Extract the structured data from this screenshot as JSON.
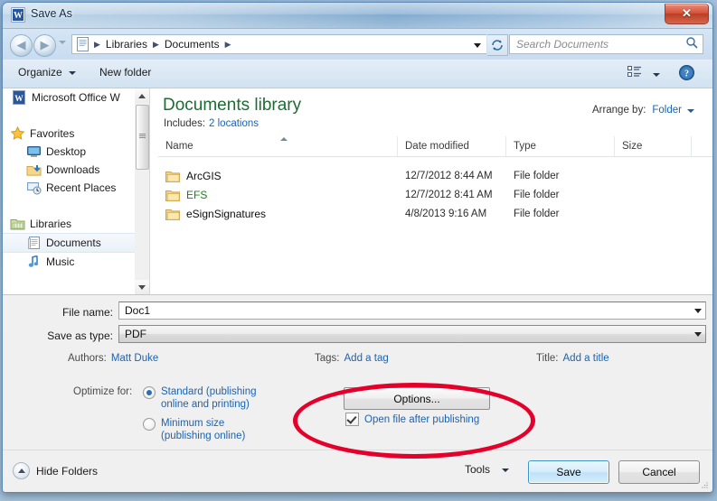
{
  "window": {
    "title": "Save As",
    "title_icon": "word-document-icon",
    "close_label": "✕"
  },
  "addressbar": {
    "back_icon": "back-arrow-icon",
    "forward_icon": "forward-arrow-icon",
    "history_icon": "history-dropdown-icon",
    "crumb_icon": "documents-library-icon",
    "crumbs": [
      "Libraries",
      "Documents"
    ],
    "separator": "▶",
    "refresh_icon": "refresh-icon",
    "search": {
      "placeholder": "Search Documents",
      "icon": "search-icon"
    }
  },
  "toolbar": {
    "organize": "Organize",
    "new_folder": "New folder",
    "view_icon": "view-list-icon",
    "help_icon": "help-icon"
  },
  "navpane": {
    "items": [
      {
        "label": "Microsoft Office W",
        "icon": "word-app-icon",
        "indent": 10,
        "selected": false
      },
      {
        "label": "",
        "icon": "spacer",
        "indent": 10,
        "selected": false
      },
      {
        "label": "Favorites",
        "icon": "favorites-star-icon",
        "indent": 8,
        "selected": false
      },
      {
        "label": "Desktop",
        "icon": "desktop-icon",
        "indent": 26,
        "selected": false
      },
      {
        "label": "Downloads",
        "icon": "downloads-icon",
        "indent": 26,
        "selected": false
      },
      {
        "label": "Recent Places",
        "icon": "recent-places-icon",
        "indent": 26,
        "selected": false
      },
      {
        "label": "",
        "icon": "spacer",
        "indent": 10,
        "selected": false
      },
      {
        "label": "Libraries",
        "icon": "libraries-icon",
        "indent": 8,
        "selected": false
      },
      {
        "label": "Documents",
        "icon": "documents-icon",
        "indent": 26,
        "selected": true
      },
      {
        "label": "Music",
        "icon": "music-icon",
        "indent": 26,
        "selected": false
      }
    ],
    "scrollbar": {
      "up_icon": "scroll-up-arrow-icon",
      "down_icon": "scroll-down-arrow-icon"
    }
  },
  "library": {
    "title": "Documents library",
    "includes_label": "Includes:",
    "includes_value": "2 locations",
    "arrange_label": "Arrange by:",
    "arrange_value": "Folder"
  },
  "filelist": {
    "columns": [
      "Name",
      "Date modified",
      "Type",
      "Size"
    ],
    "sorted_column": "Name",
    "rows": [
      {
        "name": "ArcGIS",
        "date": "12/7/2012 8:44 AM",
        "type": "File folder",
        "size": "",
        "encrypted": false
      },
      {
        "name": "EFS",
        "date": "12/7/2012 8:41 AM",
        "type": "File folder",
        "size": "",
        "encrypted": true
      },
      {
        "name": "eSignSignatures",
        "date": "4/8/2013 9:16 AM",
        "type": "File folder",
        "size": "",
        "encrypted": false
      }
    ]
  },
  "form": {
    "filename_label": "File name:",
    "filename_value": "Doc1",
    "savetype_label": "Save as type:",
    "savetype_value": "PDF",
    "authors_label": "Authors:",
    "authors_value": "Matt Duke",
    "tags_label": "Tags:",
    "tags_value": "Add a tag",
    "title_label": "Title:",
    "title_value": "Add a title",
    "optimize_label": "Optimize for:",
    "optimize_options": [
      {
        "line1": "Standard (publishing",
        "line2": "online and printing)",
        "checked": true
      },
      {
        "line1": "Minimum size",
        "line2": "(publishing online)",
        "checked": false
      }
    ],
    "options_button": "Options...",
    "open_after_publishing": "Open file after publishing",
    "open_after_publishing_checked": true
  },
  "footer": {
    "hide_folders": "Hide Folders",
    "hide_folders_icon": "chevron-up-icon",
    "tools": "Tools",
    "save": "Save",
    "cancel": "Cancel",
    "resize_grip_icon": "resize-grip-icon"
  },
  "annotation": {
    "shape": "ellipse",
    "color": "#e4002b"
  }
}
